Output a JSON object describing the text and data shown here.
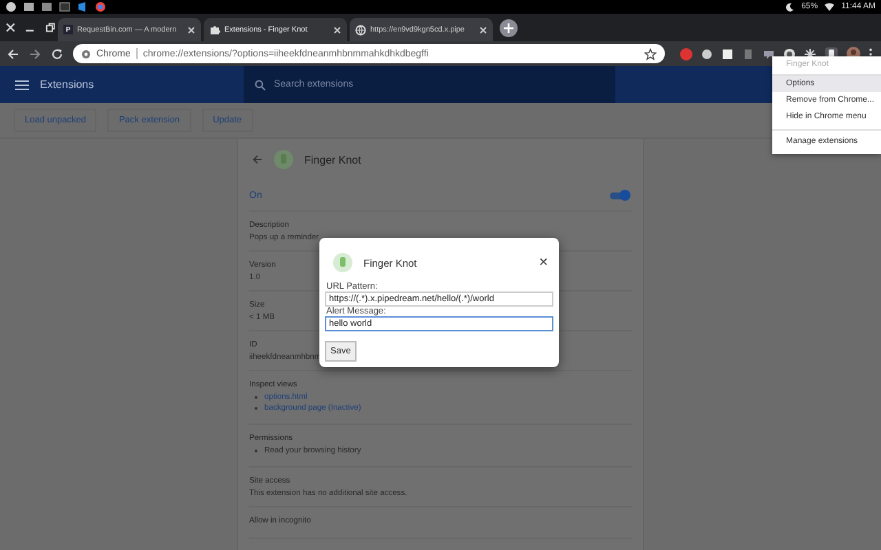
{
  "system_bar": {
    "battery": "65%",
    "time": "11:44 AM"
  },
  "tabs": [
    {
      "title": "RequestBin.com — A modern",
      "kind": "letter",
      "icon_text": "P",
      "selected": false
    },
    {
      "title": "Extensions - Finger Knot",
      "kind": "puzzle",
      "selected": true
    },
    {
      "title": "https://en9vd9kgn5cd.x.pipe",
      "kind": "globe",
      "selected": false
    }
  ],
  "address_bar": {
    "origin": "Chrome",
    "url": "chrome://extensions/?options=iiheekfdneanmhbnmmahkdhkdbegffi"
  },
  "header": {
    "title": "Extensions",
    "search_placeholder": "Search extensions"
  },
  "dev_buttons": [
    "Load unpacked",
    "Pack extension",
    "Update"
  ],
  "extension": {
    "name": "Finger Knot",
    "state_label": "On",
    "enabled": true,
    "sections": [
      {
        "kind": "text",
        "heading": "Description",
        "lines": [
          "Pops up a reminder"
        ]
      },
      {
        "kind": "text",
        "heading": "Version",
        "lines": [
          "1.0"
        ]
      },
      {
        "kind": "text",
        "heading": "Size",
        "lines": [
          "< 1 MB"
        ]
      },
      {
        "kind": "text",
        "heading": "ID",
        "lines": [
          "iiheekfdneanmhbnm"
        ]
      },
      {
        "kind": "links",
        "heading": "Inspect views",
        "lines": [
          "options.html",
          "background page (Inactive)"
        ]
      },
      {
        "kind": "bullets",
        "heading": "Permissions",
        "lines": [
          "Read your browsing history"
        ]
      },
      {
        "kind": "text",
        "heading": "Site access",
        "lines": [
          "This extension has no additional site access."
        ]
      },
      {
        "kind": "heading",
        "heading": "Allow in incognito"
      }
    ]
  },
  "dialog": {
    "title": "Finger Knot",
    "close": "×",
    "fields": [
      {
        "label": "URL Pattern:",
        "value": "https://(.*).x.pipedream.net/hello/(.*)/world",
        "focused": false
      },
      {
        "label": "Alert Message:",
        "value": "hello world",
        "focused": true
      }
    ],
    "button": "Save"
  },
  "menu": {
    "header": "Finger Knot",
    "items": [
      {
        "label": "Options",
        "selected": true,
        "divider_before": false
      },
      {
        "label": "Remove from Chrome...",
        "selected": false,
        "divider_before": false
      },
      {
        "label": "Hide in Chrome menu",
        "selected": false,
        "divider_before": false
      },
      {
        "label": "Manage extensions",
        "selected": false,
        "divider_before": true
      }
    ]
  }
}
